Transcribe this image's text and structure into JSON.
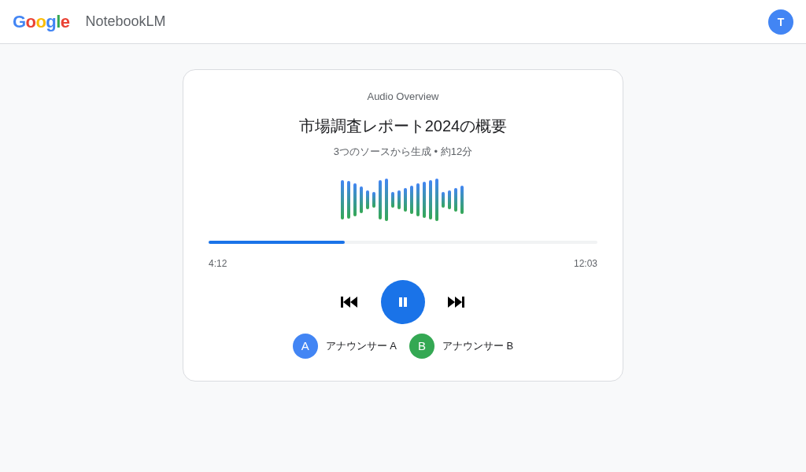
{
  "header": {
    "logo": "Google",
    "product": "NotebookLM",
    "avatar": "T"
  },
  "player": {
    "label": "Audio Overview",
    "title": "市場調査レポート2024の概要",
    "subtitle": "3つのソースから生成 • 約12分",
    "progress": {
      "level": 0.35,
      "elapsed": "4:12",
      "total": "12:03"
    },
    "playing": true,
    "speakers": [
      {
        "initial": "A",
        "name": "アナウンサー A",
        "color": "#4285f4"
      },
      {
        "initial": "B",
        "name": "アナウンサー B",
        "color": "#34a853"
      }
    ]
  }
}
